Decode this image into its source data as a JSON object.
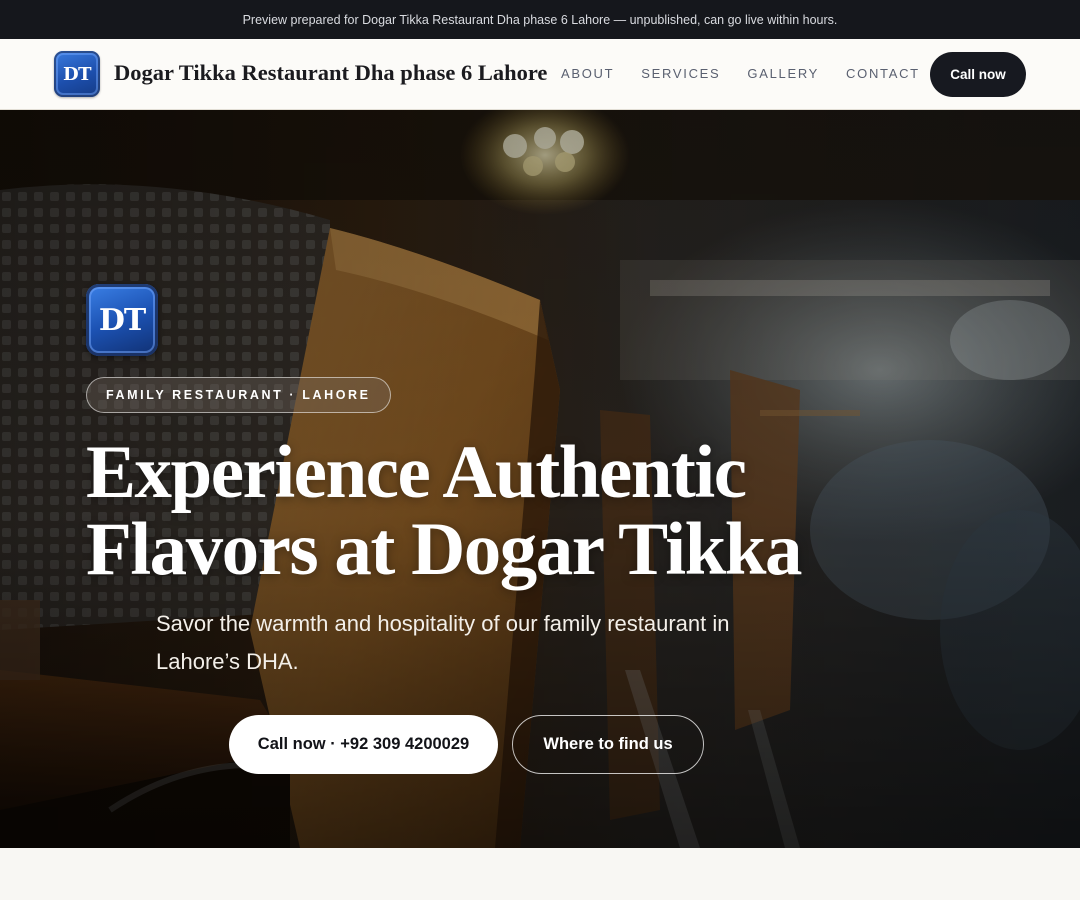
{
  "preview_bar": {
    "text": "Preview prepared for Dogar Tikka Restaurant Dha phase 6 Lahore — unpublished, can go live within hours."
  },
  "header": {
    "logo_text": "DT",
    "site_title": "Dogar Tikka Restaurant Dha phase 6 Lahore",
    "nav": [
      {
        "label": "ABOUT"
      },
      {
        "label": "SERVICES"
      },
      {
        "label": "GALLERY"
      },
      {
        "label": "CONTACT"
      }
    ],
    "cta_label": "Call now"
  },
  "hero": {
    "logo_text": "DT",
    "eyebrow": "FAMILY RESTAURANT · LAHORE",
    "title_line1": "Experience Authentic",
    "title_line2": "Flavors at Dogar Tikka",
    "subtitle": "Savor the warmth and hospitality of our family restaurant in Lahore’s DHA.",
    "primary_button": "Call now · +92 309 4200029",
    "secondary_button": "Where to find us",
    "background_image": "restaurant-interior-photo"
  },
  "colors": {
    "preview_bar_bg": "#15171c",
    "header_bg": "#fcfbf8",
    "dark_button": "#171920",
    "logo_blue": "#1d4fad",
    "page_bg": "#f8f7f3"
  }
}
